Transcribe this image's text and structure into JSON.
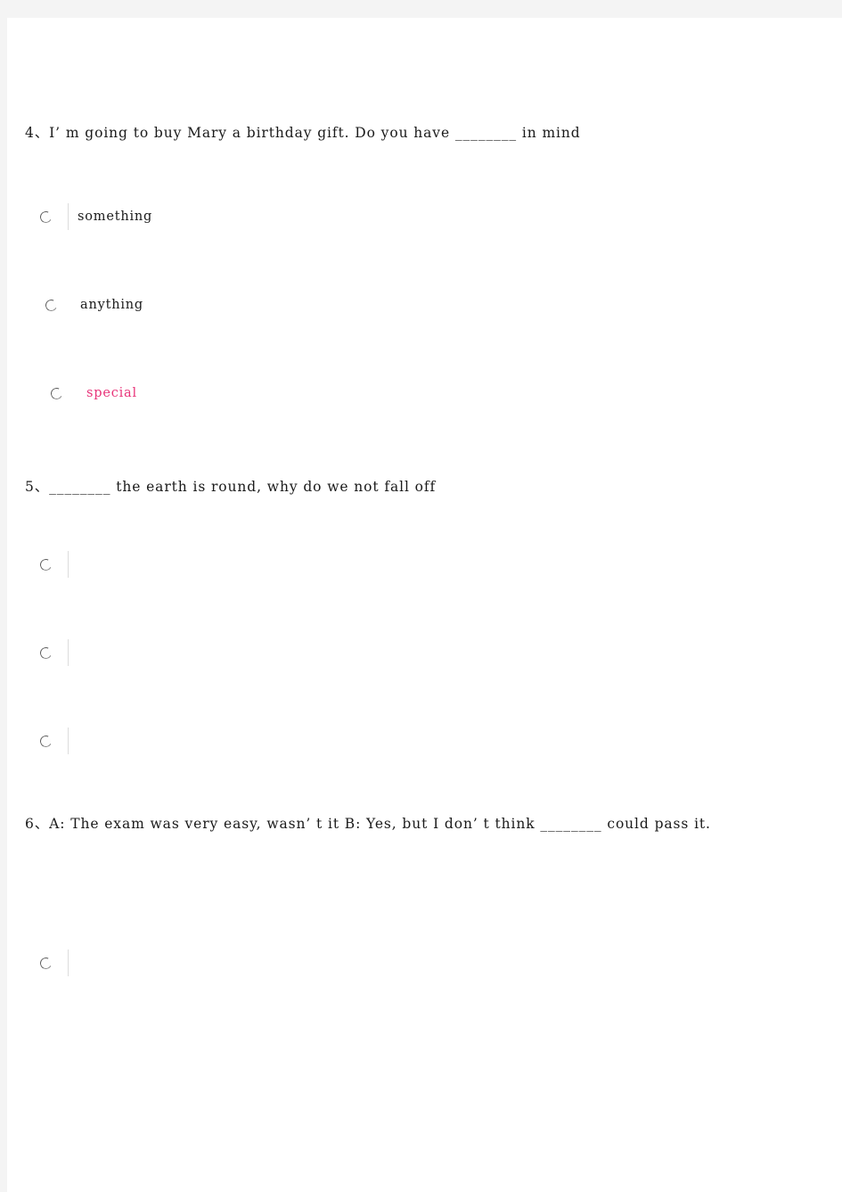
{
  "page": {
    "background_color": "#f4f4f4",
    "sheet_color": "#ffffff",
    "text_color": "#1a1a1a",
    "accent_color": "#e8357a",
    "divider_color": "#dcdcdc"
  },
  "questions": [
    {
      "number": "4",
      "stem": "4、I’ m going to buy Mary a birthday gift. Do you have ________ in mind",
      "options": [
        {
          "label": "something",
          "selected": false,
          "highlighted": false,
          "has_divider": true
        },
        {
          "label": "anything",
          "selected": false,
          "highlighted": false,
          "has_divider": false
        },
        {
          "label": "special",
          "selected": false,
          "highlighted": true,
          "has_divider": false
        }
      ]
    },
    {
      "number": "5",
      "stem": "5、________ the earth is round, why do we not fall off",
      "options": [
        {
          "label": "",
          "selected": false,
          "highlighted": false,
          "has_divider": true
        },
        {
          "label": "",
          "selected": false,
          "highlighted": false,
          "has_divider": true
        },
        {
          "label": "",
          "selected": false,
          "highlighted": false,
          "has_divider": true
        }
      ]
    },
    {
      "number": "6",
      "stem": "6、A: The exam was very easy, wasn’ t it B: Yes, but I don’ t think ________ could pass it.",
      "options": [
        {
          "label": "",
          "selected": false,
          "highlighted": false,
          "has_divider": true
        }
      ]
    }
  ]
}
